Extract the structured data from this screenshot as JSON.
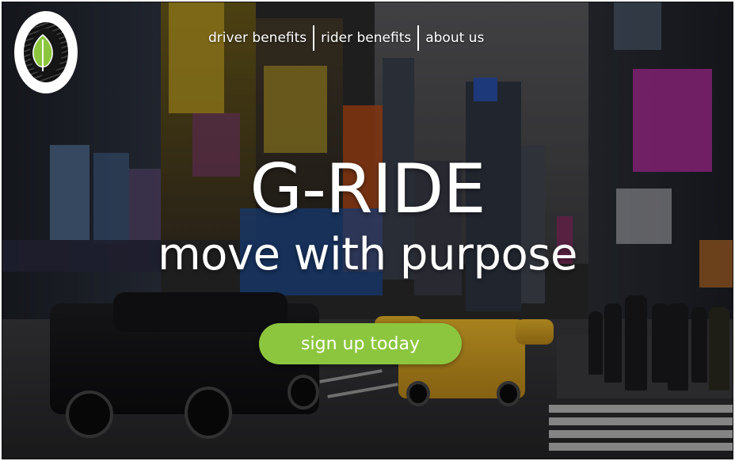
{
  "brand": {
    "logo_icon": "leaf-in-tire-icon"
  },
  "nav": {
    "items": [
      {
        "label": "driver benefits"
      },
      {
        "label": "rider benefits"
      },
      {
        "label": "about us"
      }
    ]
  },
  "hero": {
    "title": "G-RIDE",
    "tagline": "move with purpose",
    "cta_label": "sign up today"
  },
  "colors": {
    "accent_green": "#8cc63f",
    "text": "#ffffff"
  }
}
